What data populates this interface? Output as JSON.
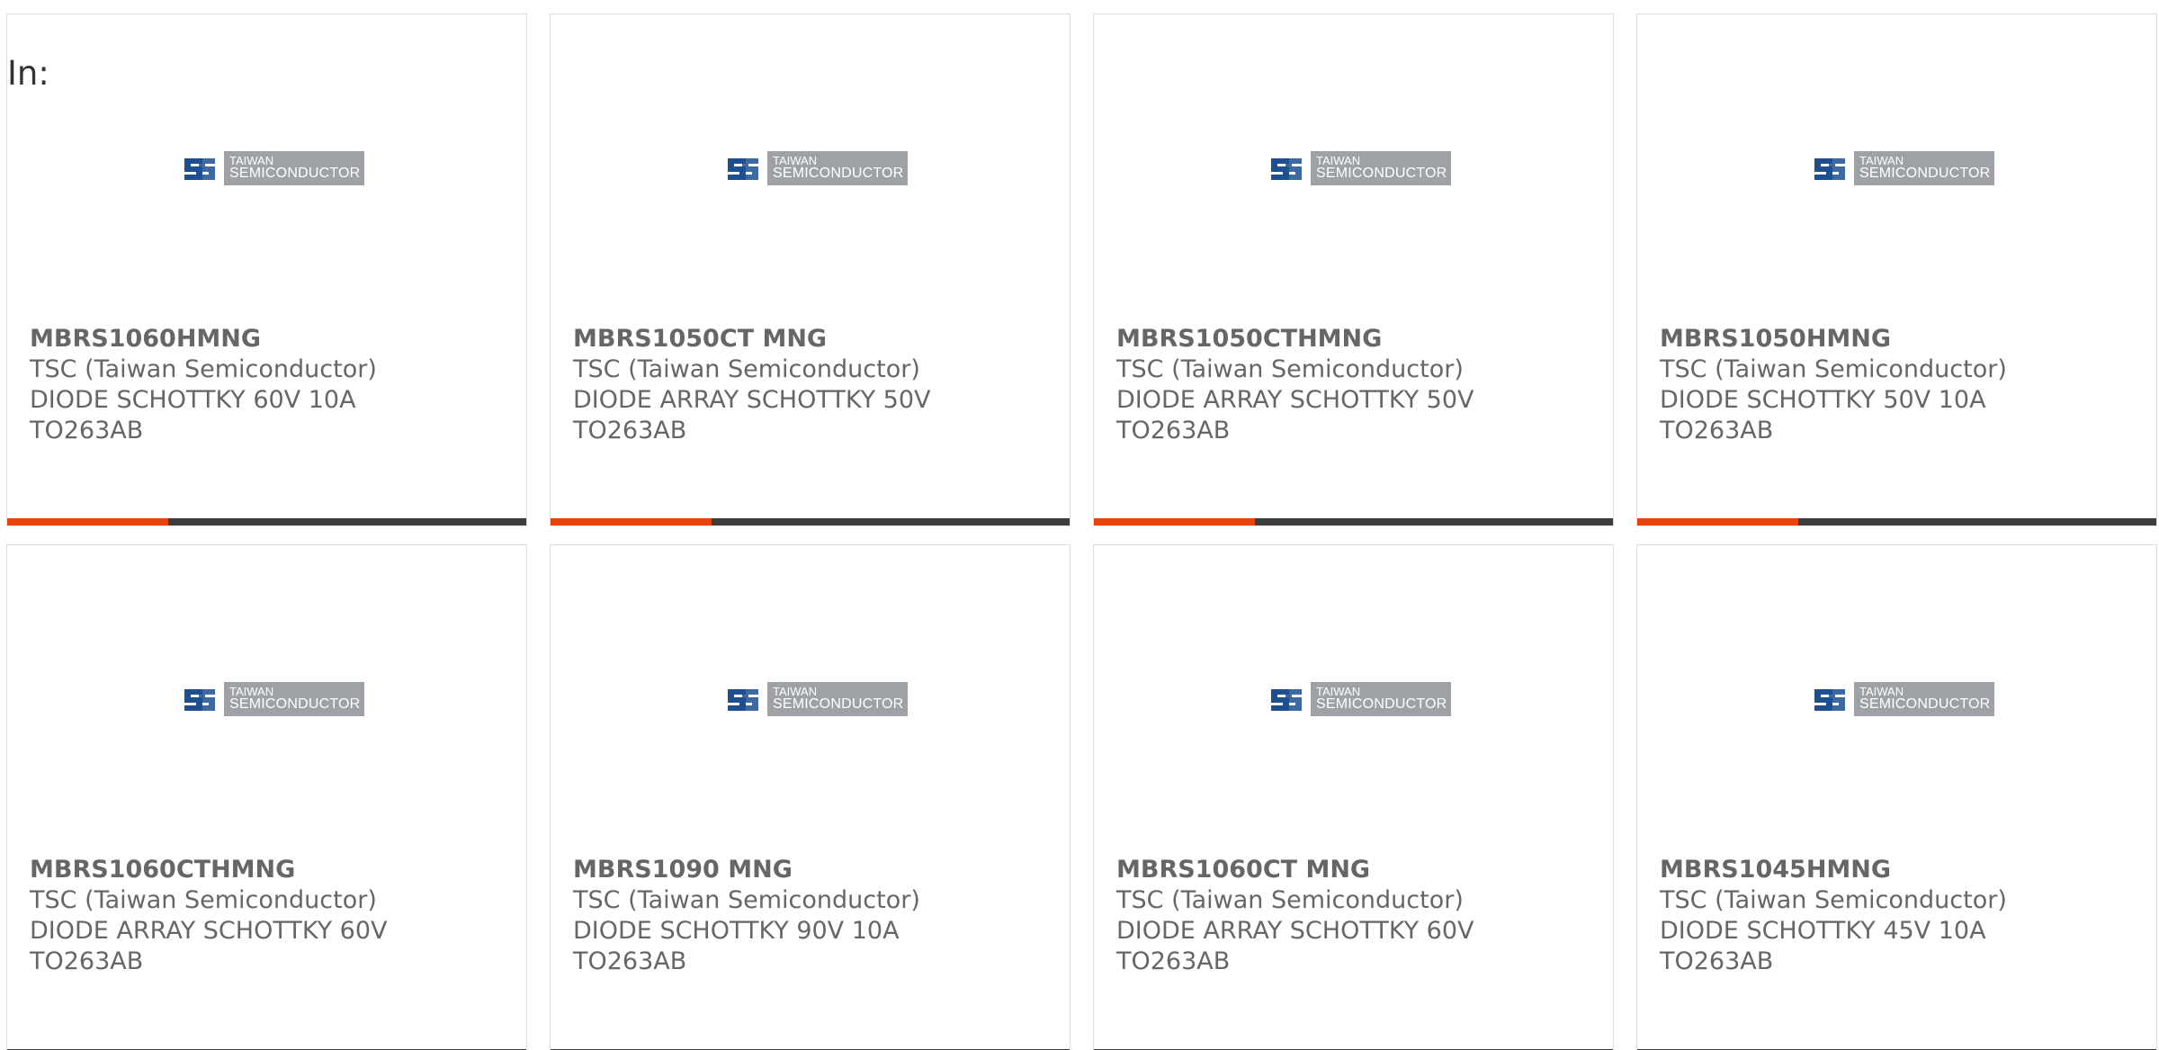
{
  "section_label": "In:",
  "logo": {
    "line1": "TAIWAN",
    "line2": "SEMICONDUCTOR",
    "mark_color": "#1d4f91",
    "plate_color": "#9ea2a6"
  },
  "accent_color": "#e8440a",
  "bar_color": "#3d3d3d",
  "products": [
    {
      "part": "MBRS1060HMNG",
      "manufacturer": "TSC (Taiwan Semiconductor)",
      "description": "DIODE SCHOTTKY 60V 10A TO263AB",
      "bar_progress": 0.31
    },
    {
      "part": "MBRS1050CT MNG",
      "manufacturer": "TSC (Taiwan Semiconductor)",
      "description": "DIODE ARRAY SCHOTTKY 50V TO263AB",
      "bar_progress": 0.31
    },
    {
      "part": "MBRS1050CTHMNG",
      "manufacturer": "TSC (Taiwan Semiconductor)",
      "description": "DIODE ARRAY SCHOTTKY 50V TO263AB",
      "bar_progress": 0.31
    },
    {
      "part": "MBRS1050HMNG",
      "manufacturer": "TSC (Taiwan Semiconductor)",
      "description": "DIODE SCHOTTKY 50V 10A TO263AB",
      "bar_progress": 0.31
    },
    {
      "part": "MBRS1060CTHMNG",
      "manufacturer": "TSC (Taiwan Semiconductor)",
      "description": "DIODE ARRAY SCHOTTKY 60V TO263AB",
      "bar_progress": 0
    },
    {
      "part": "MBRS1090 MNG",
      "manufacturer": "TSC (Taiwan Semiconductor)",
      "description": "DIODE SCHOTTKY 90V 10A TO263AB",
      "bar_progress": 0
    },
    {
      "part": "MBRS1060CT MNG",
      "manufacturer": "TSC (Taiwan Semiconductor)",
      "description": "DIODE ARRAY SCHOTTKY 60V TO263AB",
      "bar_progress": 0
    },
    {
      "part": "MBRS1045HMNG",
      "manufacturer": "TSC (Taiwan Semiconductor)",
      "description": "DIODE SCHOTTKY 45V 10A TO263AB",
      "bar_progress": 0
    }
  ]
}
